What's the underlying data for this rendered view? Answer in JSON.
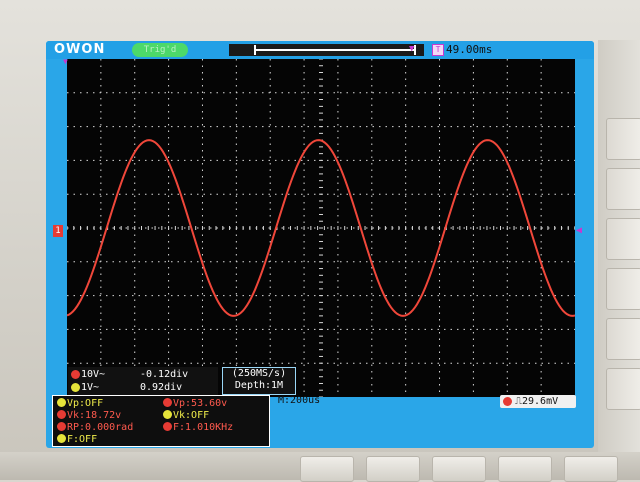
{
  "brand": {
    "logo_text": "OWON"
  },
  "status_bar": {
    "trigger_state": "Trig'd",
    "timebase_icon": "T",
    "trigger_delay": "49.00ms",
    "timeline_marker_icon": "triangle-down-icon"
  },
  "channels": [
    {
      "id": "CH1",
      "scale": "10V~",
      "position": "-0.12div",
      "color": "#e63b34"
    },
    {
      "id": "CH2",
      "scale": "1V~",
      "position": "0.92div",
      "color": "#e5e33a"
    }
  ],
  "marker_labels": {
    "ch1": "1"
  },
  "acquisition": {
    "sample_rate": "(250MS/s)",
    "depth": "Depth:1M"
  },
  "measurements": {
    "left": [
      {
        "text": "Vp:OFF",
        "color": "yellow"
      },
      {
        "text": "Vk:18.72v",
        "color": "red"
      },
      {
        "text": "RP:0.000rad",
        "color": "red"
      },
      {
        "text": "F:OFF",
        "color": "yellow"
      }
    ],
    "right": [
      {
        "text": "Vp:53.60v",
        "color": "red"
      },
      {
        "text": "Vk:OFF",
        "color": "yellow"
      },
      {
        "text": "F:1.010KHz",
        "color": "red"
      }
    ]
  },
  "horizontal": {
    "scale": "M:200us"
  },
  "trigger": {
    "level": "29.6mV",
    "edge_icon": "rising-edge-icon",
    "level_marker_icon": "triangle-left-icon"
  },
  "waveform": {
    "color": "#f0473a",
    "cycles_visible": 3,
    "frequency": "1.010KHz"
  },
  "colors": {
    "screen_bg": "#2aa6e8",
    "plot_bg": "#050505",
    "grid": "#d8d8d8",
    "accent_magenta": "#c63ad0"
  }
}
